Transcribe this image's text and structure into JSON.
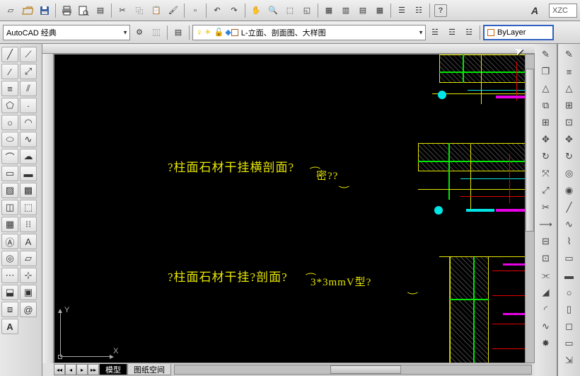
{
  "title_bar": {},
  "workspace_dropdown": "AutoCAD 经典",
  "layer_dropdown_text": "L-立面、剖面图、大样图",
  "bylayer_text": "ByLayer",
  "xzc_label": "XZC",
  "A_button": "A",
  "help_label": "?",
  "canvas_texts": {
    "t1": "?柱面石材干挂横剖面?",
    "t1b": "密??",
    "t2": "?柱面石材干挂?剖面?",
    "t2b": "3*3mmV型?"
  },
  "ucs": {
    "x": "X",
    "y": "Y"
  },
  "tabs": {
    "model": "模型",
    "paper": "图纸空间"
  },
  "toolbar1_icons": [
    "new",
    "open",
    "save",
    "sep",
    "print",
    "preview",
    "publish",
    "sep",
    "cut",
    "copy",
    "paste",
    "match",
    "sep",
    "blockedit",
    "sep",
    "undo",
    "redo",
    "sep",
    "pan",
    "zoomrt",
    "zoomwin",
    "zoomprev",
    "sep",
    "props",
    "sheet",
    "toolpal",
    "calc",
    "sep",
    "group",
    "ungroup",
    "sep",
    "help"
  ],
  "left_tools": [
    [
      "line",
      "pline"
    ],
    [
      "cline",
      "ray"
    ],
    [
      "arc1",
      "multi"
    ],
    [
      "polygon",
      "point"
    ],
    [
      "circle",
      "arc"
    ],
    [
      "ellipse",
      "spline"
    ],
    [
      "earc",
      "cloud"
    ],
    [
      "rect",
      "mask"
    ],
    [
      "hatch",
      "grad"
    ],
    [
      "region",
      "solid"
    ],
    [
      "table",
      "array"
    ],
    [
      "text1",
      "text2"
    ],
    [
      "boundary",
      "mtext"
    ],
    [
      "donut",
      "insert"
    ],
    [
      "block",
      "wblock"
    ],
    [
      "attdef",
      "edit"
    ],
    [
      "A",
      ""
    ]
  ],
  "right_tools_outer": [
    "highlight",
    "measure",
    "angle",
    "grid",
    "grid2",
    "pan-cross",
    "orbit",
    "nav",
    "nav2",
    "line-tool",
    "curve",
    "spline2",
    "rect2",
    "rect3",
    "circle3",
    "rect4",
    "square",
    "rect5",
    "export"
  ],
  "right_tools_inner": [
    "erase",
    "copy2",
    "mirror",
    "offset",
    "array2",
    "move",
    "rotate",
    "scale",
    "stretch",
    "trim",
    "extend",
    "break",
    "breakat",
    "join",
    "chamfer",
    "fillet",
    "blend",
    "explode"
  ]
}
